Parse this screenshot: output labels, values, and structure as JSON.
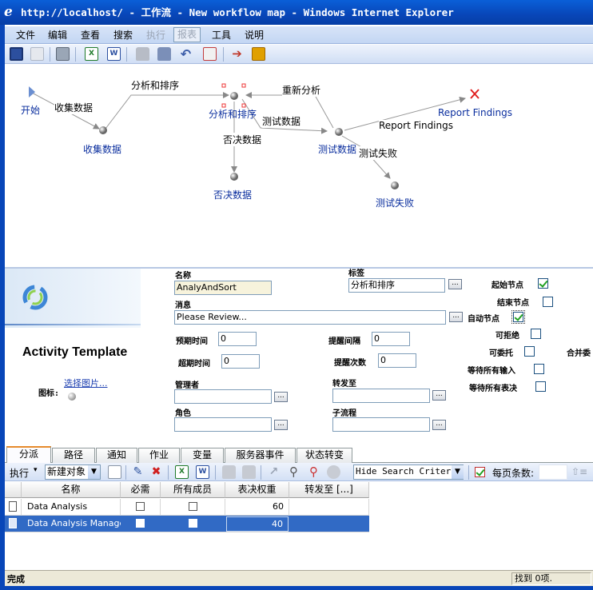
{
  "window": {
    "title": "http://localhost/ - 工作流 - New workflow map - Windows Internet Explorer"
  },
  "menu": {
    "file": "文件",
    "edit": "编辑",
    "view": "查看",
    "search": "搜索",
    "run": "执行",
    "report": "报表",
    "tools": "工具",
    "help": "说明"
  },
  "map": {
    "nodes": {
      "start": "开始",
      "collect": "收集数据",
      "analyze": "分析和排序",
      "reject": "否决数据",
      "test": "测试数据",
      "fail": "测试失败",
      "findings": "Report Findings"
    },
    "edges": {
      "collect": "收集数据",
      "analyze": "分析和排序",
      "reanalyze": "重新分析",
      "test": "测试数据",
      "reject": "否决数据",
      "findings": "Report Findings",
      "fail": "测试失败"
    }
  },
  "activity": {
    "template_title": "Activity Template",
    "choose_image": "选择图片...",
    "icon_label": "图标:",
    "name_label": "名称",
    "name_value": "AnalyAndSort",
    "tag_label": "标签",
    "tag_value": "分析和排序",
    "message_label": "消息",
    "message_value": "Please Review...",
    "expected_time_label": "预期时间",
    "expected_time": "0",
    "remind_interval_label": "提醒间隔",
    "remind_interval": "0",
    "timeout_label": "超期时间",
    "timeout": "0",
    "remind_count_label": "提醒次数",
    "remind_count": "0",
    "manager_label": "管理者",
    "manager_value": "",
    "forward_label": "转发至",
    "forward_value": "",
    "role_label": "角色",
    "role_value": "",
    "subflow_label": "子流程",
    "subflow_value": "",
    "ellipsis": "...",
    "start_node_label": "起始节点",
    "end_node_label": "结束节点",
    "auto_node_label": "自动节点",
    "can_reject_label": "可拒绝",
    "can_delegate_label": "可委托",
    "merge_label": "合并委",
    "wait_input_label": "等待所有输入",
    "wait_vote_label": "等待所有表决"
  },
  "tabs": [
    "分派",
    "路径",
    "通知",
    "作业",
    "变量",
    "服务器事件",
    "状态转变"
  ],
  "gridtoolbar": {
    "execute": "执行",
    "new_object": "新建对象",
    "search_criteria": "Hide Search Criteria",
    "page_size_label": "每页条数:"
  },
  "grid": {
    "headers": [
      "名称",
      "必需",
      "所有成员",
      "表决权重",
      "转发至 [...]"
    ],
    "rows": [
      {
        "name": "Data Analysis",
        "weight": "60"
      },
      {
        "name": "Data Analysis Manager",
        "weight": "40"
      }
    ]
  },
  "status": {
    "left": "完成",
    "right": "找到 0项."
  },
  "colors": {
    "titlebar": "#0846b8",
    "menubar": "#c3d6f3",
    "node_label": "#0a2e9e",
    "selected_row": "#316ac5",
    "check": "#21a121"
  }
}
